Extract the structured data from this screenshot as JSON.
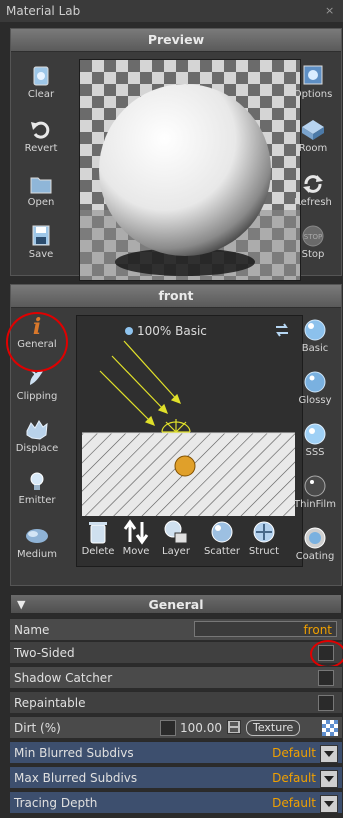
{
  "window": {
    "title": "Material Lab",
    "close": "×"
  },
  "preview": {
    "header": "Preview",
    "left_buttons": [
      "Clear",
      "Revert",
      "Open",
      "Save"
    ],
    "right_buttons": [
      "Options",
      "Room",
      "Refresh",
      "Stop"
    ],
    "stop_badge": "STOP"
  },
  "front": {
    "header": "front",
    "layer_label": "100% Basic",
    "left_buttons": [
      "General",
      "Clipping",
      "Displace",
      "Emitter",
      "Medium"
    ],
    "right_buttons": [
      "Basic",
      "Glossy",
      "SSS",
      "ThinFilm",
      "Coating"
    ],
    "tools": [
      "Delete",
      "Move",
      "Layer",
      "Scatter",
      "Struct"
    ]
  },
  "general": {
    "header": "General",
    "rows": {
      "name_label": "Name",
      "name_value": "front",
      "two_sided": "Two-Sided",
      "shadow_catcher": "Shadow Catcher",
      "repaintable": "Repaintable",
      "dirt": "Dirt (%)",
      "dirt_value": "100.00",
      "texture_btn": "Texture",
      "min_blur": "Min Blurred Subdivs",
      "min_blur_value": "Default",
      "max_blur": "Max Blurred Subdivs",
      "max_blur_value": "Default",
      "tracing_depth": "Tracing Depth",
      "tracing_depth_value": "Default"
    }
  },
  "colors": {
    "accent": "#f0a000",
    "highlight": "#e00000",
    "blue_row": "#3d4f6e"
  }
}
